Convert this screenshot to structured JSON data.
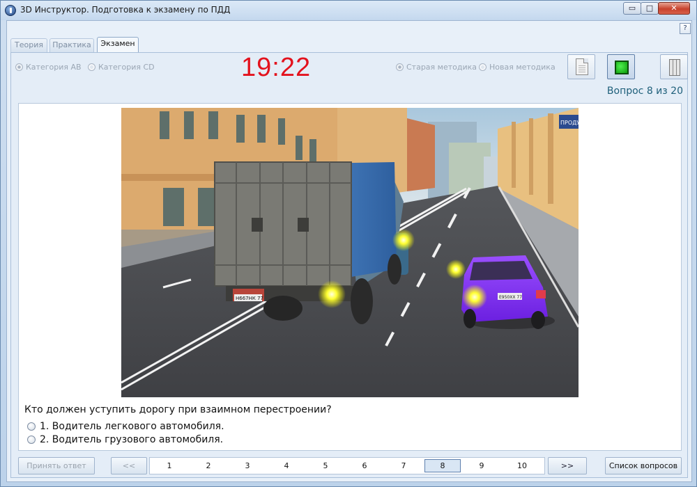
{
  "window": {
    "title": "3D Инструктор. Подготовка к экзамену по ПДД",
    "controls": {
      "minimize": "▭",
      "maximize": "□",
      "close": "✕"
    }
  },
  "help": {
    "label": "?"
  },
  "tabs": [
    {
      "label": "Теория",
      "active": false
    },
    {
      "label": "Практика",
      "active": false
    },
    {
      "label": "Экзамен",
      "active": true
    }
  ],
  "toolbar": {
    "category_ab": "Категория AB",
    "category_cd": "Категория CD",
    "timer": "19:22",
    "method_old": "Старая методика",
    "method_new": "Новая методика",
    "buttons": [
      "document-icon",
      "green-square-icon",
      "columns-icon"
    ]
  },
  "question": {
    "counter": "Вопрос 8 из 20",
    "text": "Кто должен уступить дорогу при взаимном перестроении?",
    "answers": [
      "1. Водитель легкового автомобиля.",
      "2. Водитель грузового автомобиля."
    ],
    "image": {
      "sign_text": "ПРОДУКТЫ",
      "truck_plate": "Н667НК 77",
      "car_plate": "Е950ХХ 77"
    }
  },
  "navigation": {
    "accept_label": "Принять ответ",
    "prev_label": "<<",
    "next_label": ">>",
    "list_label": "Список вопросов",
    "pages": [
      "1",
      "2",
      "3",
      "4",
      "5",
      "6",
      "7",
      "8",
      "9",
      "10"
    ],
    "current_page": "8"
  },
  "colors": {
    "timer": "#e3121d",
    "counter": "#1e5f7a",
    "accent": "#5d7fae"
  }
}
